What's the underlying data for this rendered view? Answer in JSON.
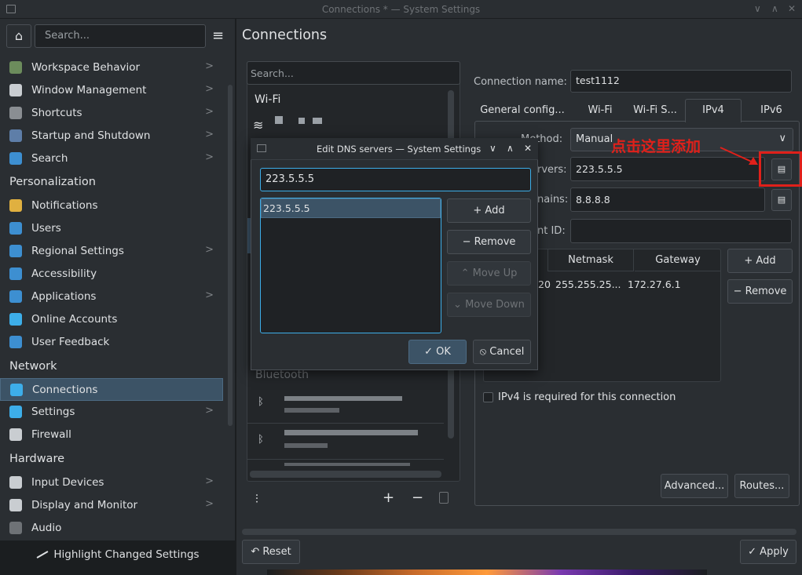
{
  "window": {
    "title": "Connections * — System Settings",
    "controls": [
      "∨",
      "∧",
      "✕"
    ]
  },
  "sidebar": {
    "search_placeholder": "Search...",
    "items": [
      {
        "label": "Workspace Behavior",
        "icon": "workspace-icon",
        "chevron": true,
        "color": "#6c8c5c"
      },
      {
        "label": "Window Management",
        "icon": "window-icon",
        "chevron": true,
        "color": "#c9cdd1"
      },
      {
        "label": "Shortcuts",
        "icon": "keyboard-icon",
        "chevron": true,
        "color": "#8a8e92"
      },
      {
        "label": "Startup and Shutdown",
        "icon": "power-icon",
        "chevron": true,
        "color": "#5e7ea8"
      },
      {
        "label": "Search",
        "icon": "search-icon",
        "chevron": true,
        "color": "#3d8fd1"
      },
      {
        "label": "Notifications",
        "icon": "bell-icon",
        "chevron": false,
        "color": "#e0b040"
      },
      {
        "label": "Users",
        "icon": "users-icon",
        "chevron": false,
        "color": "#3d8fd1"
      },
      {
        "label": "Regional Settings",
        "icon": "flag-icon",
        "chevron": true,
        "color": "#3d8fd1"
      },
      {
        "label": "Accessibility",
        "icon": "accessibility-icon",
        "chevron": false,
        "color": "#3d8fd1"
      },
      {
        "label": "Applications",
        "icon": "apps-icon",
        "chevron": true,
        "color": "#3d8fd1"
      },
      {
        "label": "Online Accounts",
        "icon": "globe-icon",
        "chevron": false,
        "color": "#3daee9"
      },
      {
        "label": "User Feedback",
        "icon": "feedback-icon",
        "chevron": false,
        "color": "#3d8fd1"
      },
      {
        "label": "Connections",
        "icon": "network-icon",
        "chevron": false,
        "color": "#3daee9",
        "selected": true
      },
      {
        "label": "Settings",
        "icon": "globe-settings-icon",
        "chevron": true,
        "color": "#3daee9"
      },
      {
        "label": "Firewall",
        "icon": "firewall-icon",
        "chevron": false,
        "color": "#c9cdd1"
      },
      {
        "label": "Input Devices",
        "icon": "input-devices-icon",
        "chevron": true,
        "color": "#c9cdd1"
      },
      {
        "label": "Display and Monitor",
        "icon": "monitor-icon",
        "chevron": true,
        "color": "#c9cdd1"
      },
      {
        "label": "Audio",
        "icon": "audio-icon",
        "chevron": false,
        "color": "#6e7276"
      }
    ],
    "sections": {
      "personalization": "Personalization",
      "network": "Network",
      "hardware": "Hardware"
    },
    "highlight_button": "Highlight Changed Settings"
  },
  "page_title": "Connections",
  "conn_list": {
    "search_placeholder": "Search...",
    "wifi_header": "Wi-Fi",
    "bluetooth_header": "Bluetooth"
  },
  "details": {
    "connection_name_label": "Connection name:",
    "connection_name_value": "test1112",
    "tabs": [
      "General config...",
      "Wi-Fi",
      "Wi-Fi S...",
      "IPv4",
      "IPv6"
    ],
    "method_label": "Method:",
    "method_value": "Manual",
    "dns_label": "rvers:",
    "dns_value": "223.5.5.5",
    "search_domains_label": "nains:",
    "search_domains_value": "8.8.8.8",
    "client_id_label": "nt ID:",
    "table_headers": [
      "Netmask",
      "Gateway"
    ],
    "table_row": {
      "address_tail": "20",
      "netmask": "255.255.25...",
      "gateway": "172.27.6.1"
    },
    "add_button": "+ Add",
    "remove_button": "Remove",
    "ipv4_required": "IPv4 is required for this connection",
    "advanced_button": "Advanced...",
    "routes_button": "Routes..."
  },
  "dialog": {
    "title": "Edit DNS servers — System Settings",
    "input_value": "223.5.5.5",
    "list_items": [
      "223.5.5.5"
    ],
    "add": "+ Add",
    "remove": "Remove",
    "move_up": "Move Up",
    "move_down": "Move Down",
    "ok": "OK",
    "cancel": "Cancel"
  },
  "annotation": "点击这里添加",
  "footer": {
    "reset": "Reset",
    "apply": "Apply"
  }
}
